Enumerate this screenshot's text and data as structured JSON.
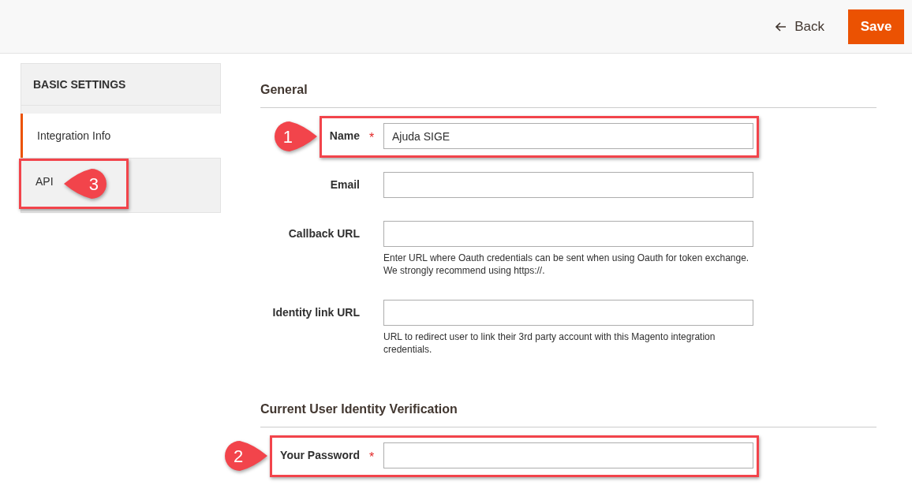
{
  "header": {
    "back_label": "Back",
    "save_label": "Save"
  },
  "sidebar": {
    "title": "BASIC SETTINGS",
    "items": [
      {
        "label": "Integration Info",
        "selected": true,
        "highlighted": false
      },
      {
        "label": "API",
        "selected": false,
        "highlighted": true,
        "callout": {
          "label": "3",
          "kind": "left"
        }
      }
    ]
  },
  "sections": [
    {
      "title": "General",
      "fields": [
        {
          "label": "Name",
          "marker": "*",
          "value": "Ajuda SIGE",
          "highlighted": true,
          "callout": {
            "label": "1",
            "kind": "right"
          }
        },
        {
          "label": "Email",
          "highlighted": false
        },
        {
          "label": "Callback URL",
          "highlighted": false,
          "note": "Enter URL where Oauth credentials can be sent when using Oauth for token exchange. We strongly recommend using https://."
        },
        {
          "label": "Identity link URL",
          "highlighted": false,
          "note": "URL to redirect user to link their 3rd party account with this Magento integration credentials."
        }
      ]
    },
    {
      "title": "Current User Identity Verification",
      "fields": [
        {
          "label": "Your Password",
          "marker": "*",
          "highlighted": true,
          "callout": {
            "label": "2",
            "kind": "right"
          }
        }
      ]
    }
  ]
}
